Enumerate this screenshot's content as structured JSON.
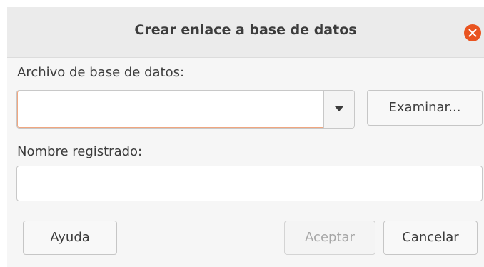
{
  "dialog": {
    "title": "Crear enlace a base de datos"
  },
  "form": {
    "database_file_label": "Archivo de base de datos:",
    "database_file_value": "",
    "browse_label": "Examinar...",
    "registered_name_label": "Nombre registrado:",
    "registered_name_value": ""
  },
  "footer": {
    "help_label": "Ayuda",
    "accept_label": "Aceptar",
    "accept_enabled": false,
    "cancel_label": "Cancelar"
  },
  "colors": {
    "close_button": "#e95420",
    "focus_border": "#f0a67f",
    "titlebar": "#ebebeb",
    "dialog_background": "#f6f6f6"
  },
  "icons": {
    "close": "close-icon",
    "dropdown": "dropdown-arrow-icon"
  }
}
